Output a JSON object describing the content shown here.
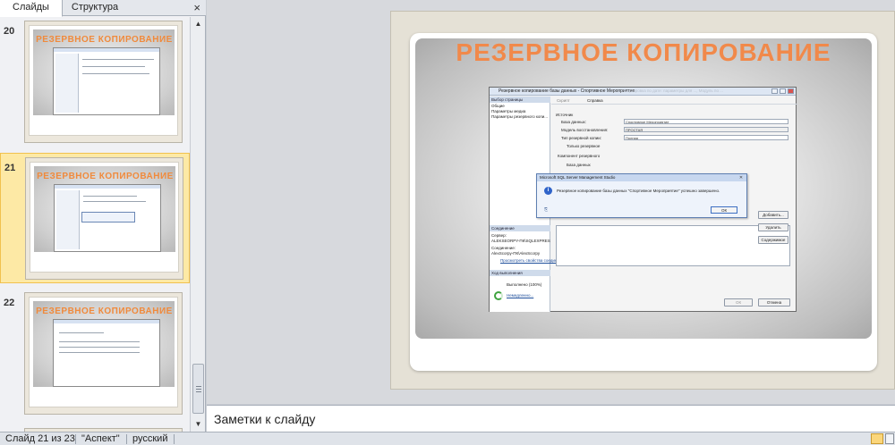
{
  "panel": {
    "tabs": [
      {
        "label": "Слайды"
      },
      {
        "label": "Структура"
      }
    ],
    "close_glyph": "×",
    "thumbnails": [
      {
        "number": "20",
        "title": "РЕЗЕРВНОЕ КОПИРОВАНИЕ"
      },
      {
        "number": "21",
        "title": "РЕЗЕРВНОЕ КОПИРОВАНИЕ"
      },
      {
        "number": "22",
        "title": "РЕЗЕРВНОЕ КОПИРОВАНИЕ"
      }
    ]
  },
  "slide": {
    "title": "РЕЗЕРВНОЕ КОПИРОВАНИЕ",
    "screenshot": {
      "window_title": "Резервное копирование базы данных - Спортивное Мероприятие",
      "ghost_text": "Сортировка по дате: параметры для ..., Модуль по ...",
      "sidebar_header_1": "Выбор страницы",
      "pages": [
        "Общие",
        "Параметры медиа",
        "Параметры резервного копи..."
      ],
      "sidebar_header_2": "Соединение",
      "server_label": "Сервер:",
      "server_value": "ALEKSEORPY-ПК\\SQLEXPRES",
      "connection_label": "Соединение:",
      "connection_value": "AlexScorpy-ПК\\AlexScorpy",
      "view_props_link": "Просмотреть свойства соединения",
      "sidebar_header_3": "Ход выполнения",
      "progress_text": "Выполнено (100%)",
      "stop_link": "Немедленно...",
      "toolbar_script": "Скрипт",
      "toolbar_help": "Справка",
      "source_label": "Источник",
      "db_label": "База данных:",
      "db_value": "Спортивное Мероприятие",
      "recovery_label": "Модель восстановления:",
      "recovery_value": "ПРОСТАЯ",
      "backup_type_label": "Тип резервной копии:",
      "backup_type_value": "Полная",
      "copy_only_label": "Только резервное",
      "component_label": "Компонент резервного",
      "database_radio": "База данных",
      "add_button": "Добавить...",
      "remove_button": "Удалить",
      "contents_button": "Содержимое",
      "ok_button": "ОК",
      "cancel_button": "Отмена",
      "msgbox": {
        "title": "Microsoft SQL Server Management Studio",
        "message": "Резервное копирование базы данных \"Спортивное Мероприятие\" успешно завершено.",
        "ok": "ОК"
      }
    }
  },
  "notes": {
    "placeholder": "Заметки к слайду"
  },
  "status": {
    "slide_info": "Слайд 21 из 23",
    "theme": "\"Аспект\"",
    "language": "русский"
  },
  "colors": {
    "title_orange": "#f1894a",
    "selected_thumb": "#fde9a5"
  }
}
